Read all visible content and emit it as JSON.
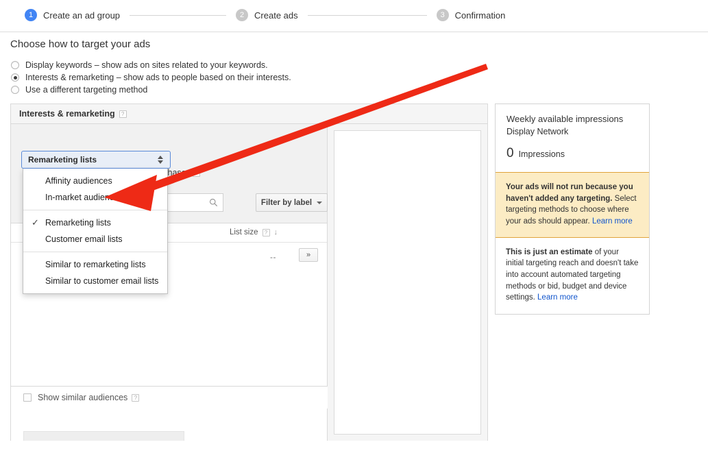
{
  "wizard": {
    "steps": [
      {
        "num": "1",
        "label": "Create an ad group",
        "state": "active"
      },
      {
        "num": "2",
        "label": "Create ads",
        "state": "inactive"
      },
      {
        "num": "3",
        "label": "Confirmation",
        "state": "inactive"
      }
    ]
  },
  "page": {
    "section_title": "Choose how to target your ads"
  },
  "targeting_options": [
    {
      "label": "Display keywords – show ads on sites related to your keywords.",
      "checked": false
    },
    {
      "label": "Interests & remarketing – show ads to people based on their interests.",
      "checked": true
    },
    {
      "label": "Use a different targeting method",
      "checked": false
    }
  ],
  "panel": {
    "title": "Interests & remarketing",
    "help_glyph": "?",
    "tagline": "may be most likely to purchase",
    "search_placeholder": "",
    "search_value": "",
    "filter_button": "Filter by label",
    "list_size_header": "List size",
    "list_size_sort_glyph": "↓",
    "row_value": "--",
    "add_all_button": "»",
    "show_similar_label": "Show similar audiences"
  },
  "dropdown": {
    "selected": "Remarketing lists",
    "check_glyph": "✓",
    "groups": [
      [
        "Affinity audiences",
        "In-market audiences"
      ],
      [
        "Remarketing lists",
        "Customer email lists"
      ],
      [
        "Similar to remarketing lists",
        "Similar to customer email lists"
      ]
    ]
  },
  "sidebar": {
    "title": "Weekly available impressions",
    "subtitle": "Display Network",
    "number": "0",
    "number_label": "Impressions",
    "warning_bold": "Your ads will not run because you haven't added any targeting.",
    "warning_rest": " Select targeting methods to choose where your ads should appear. ",
    "warning_link": "Learn more",
    "note_bold": "This is just an estimate",
    "note_rest": " of your initial targeting reach and doesn't take into account automated targeting methods or bid, budget and device settings.",
    "note_link": "Learn more"
  },
  "annotation": {
    "arrow_color": "#ee2a16"
  }
}
